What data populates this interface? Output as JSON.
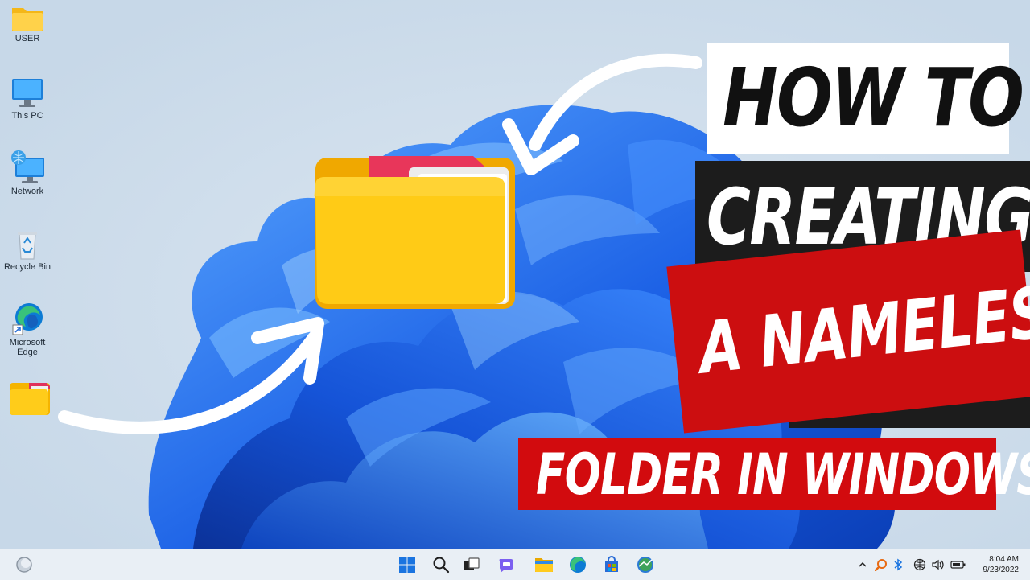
{
  "desktop": {
    "icons": [
      {
        "label": "USER"
      },
      {
        "label": "This PC"
      },
      {
        "label": "Network"
      },
      {
        "label": "Recycle Bin"
      },
      {
        "label": "Microsoft Edge"
      },
      {
        "label": ""
      }
    ]
  },
  "title": {
    "line1": "HOW TO",
    "line2": "CREATING",
    "line3": "A NAMELESS",
    "line4": "FOLDER IN WINDOWS"
  },
  "colors": {
    "accent_red": "#cc0e10",
    "dark_band": "#1c1c1c",
    "wallpaper_blue": "#1f6fe8",
    "folder_yellow": "#ffc21a"
  },
  "taskbar": {
    "weather_icon": "weather-icon",
    "apps": [
      "start-icon",
      "search-icon",
      "task-view-icon",
      "chat-icon",
      "file-explorer-icon",
      "edge-icon",
      "store-icon",
      "app-icon"
    ],
    "tray": [
      "chevron-up-icon",
      "search-app-icon",
      "bluetooth-icon",
      "network-icon",
      "volume-icon",
      "battery-icon"
    ],
    "time": "8:04 AM",
    "date": "9/23/2022"
  }
}
